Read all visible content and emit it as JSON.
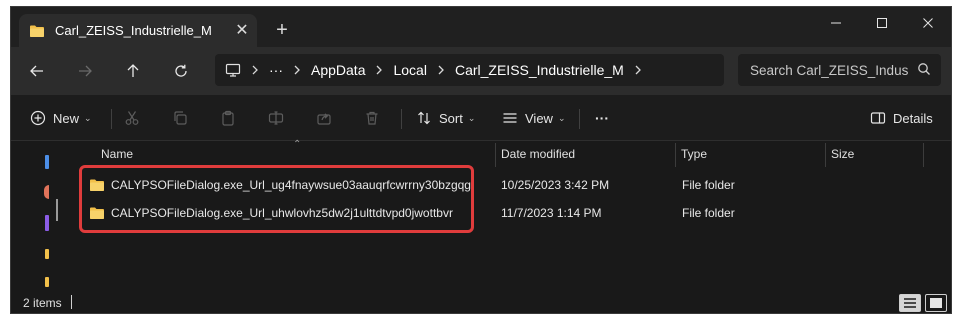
{
  "tab": {
    "title": "Carl_ZEISS_Industrielle_M",
    "close_glyph": "✕",
    "new_glyph": "+"
  },
  "window_controls": {
    "minimize": "—",
    "maximize": "☐",
    "close": "✕"
  },
  "address": {
    "more": "···",
    "crumbs": [
      "AppData",
      "Local",
      "Carl_ZEISS_Industrielle_M"
    ]
  },
  "search": {
    "placeholder": "Search Carl_ZEISS_Indus"
  },
  "commands": {
    "new_label": "New",
    "sort_label": "Sort",
    "view_label": "View",
    "more": "···",
    "details_label": "Details"
  },
  "columns": {
    "name": "Name",
    "date": "Date modified",
    "type": "Type",
    "size": "Size"
  },
  "files": [
    {
      "name": "CALYPSOFileDialog.exe_Url_ug4fnaywsue03aauqrfcwrrny30bzgqg",
      "date": "10/25/2023 3:42 PM",
      "type": "File folder"
    },
    {
      "name": "CALYPSOFileDialog.exe_Url_uhwlovhz5dw2j1ulttdtvpd0jwottbvr",
      "date": "11/7/2023 1:14 PM",
      "type": "File folder"
    }
  ],
  "status": {
    "item_count": "2 items"
  },
  "colors": {
    "folder": "#f2c04a",
    "highlight": "#e03c3c",
    "accent": "#4c8ee6"
  }
}
